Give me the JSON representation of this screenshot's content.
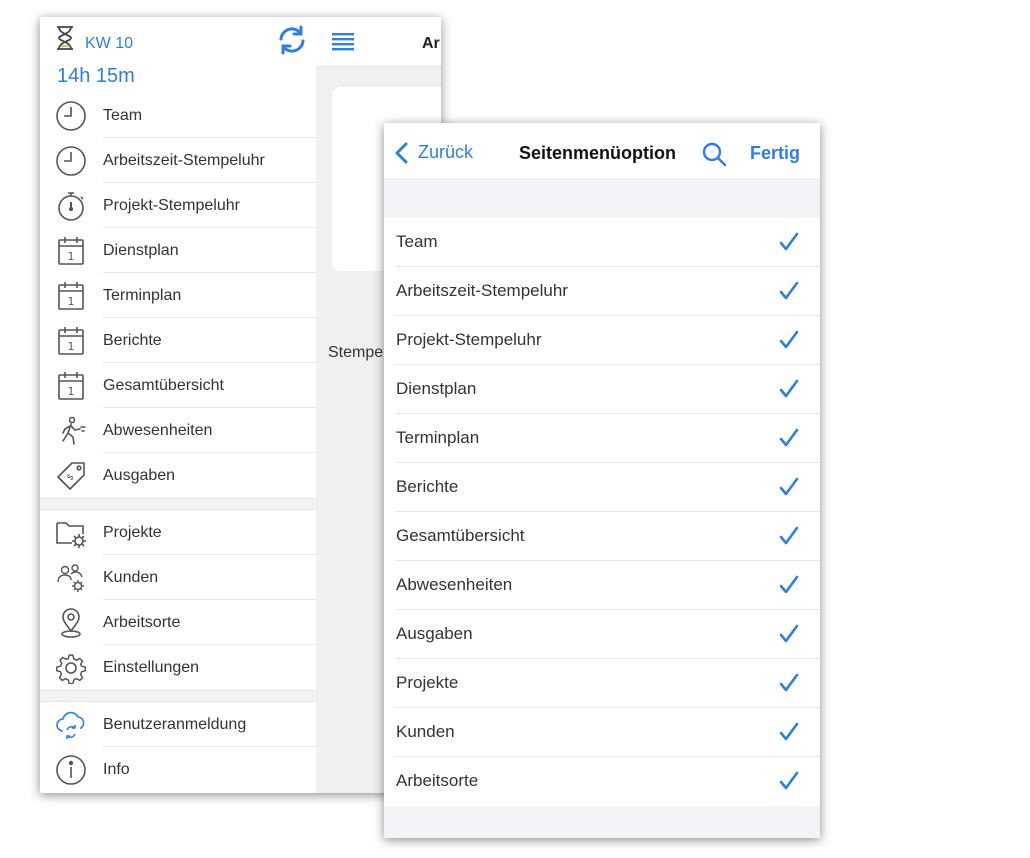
{
  "colors": {
    "accent": "#2f7ee0",
    "icon_gray": "#555555",
    "hourglass_sand": "#e0c066"
  },
  "back_screen": {
    "week_label": "KW 10",
    "hours_label": "14h 15m",
    "main_title_partial": "Ar",
    "main_text_partial": "Stempe",
    "menu_groups": [
      [
        {
          "label": "Team",
          "icon": "clock-icon"
        },
        {
          "label": "Arbeitszeit-Stempeluhr",
          "icon": "clock-icon"
        },
        {
          "label": "Projekt-Stempeluhr",
          "icon": "stopwatch-icon"
        },
        {
          "label": "Dienstplan",
          "icon": "calendar-icon"
        },
        {
          "label": "Terminplan",
          "icon": "calendar-icon"
        },
        {
          "label": "Berichte",
          "icon": "calendar-icon"
        },
        {
          "label": "Gesamtübersicht",
          "icon": "calendar-icon"
        },
        {
          "label": "Abwesenheiten",
          "icon": "running-person-icon"
        },
        {
          "label": "Ausgaben",
          "icon": "price-tag-icon"
        }
      ],
      [
        {
          "label": "Projekte",
          "icon": "folder-gear-icon"
        },
        {
          "label": "Kunden",
          "icon": "people-gear-icon"
        },
        {
          "label": "Arbeitsorte",
          "icon": "location-pin-icon"
        },
        {
          "label": "Einstellungen",
          "icon": "gear-icon"
        }
      ],
      [
        {
          "label": "Benutzeranmeldung",
          "icon": "cloud-sync-icon"
        },
        {
          "label": "Info",
          "icon": "info-icon"
        }
      ]
    ]
  },
  "front_screen": {
    "back_label": "Zurück",
    "title": "Seitenmenüoption",
    "done_label": "Fertig",
    "options": [
      {
        "label": "Team",
        "checked": true
      },
      {
        "label": "Arbeitszeit-Stempeluhr",
        "checked": true
      },
      {
        "label": "Projekt-Stempeluhr",
        "checked": true
      },
      {
        "label": "Dienstplan",
        "checked": true
      },
      {
        "label": "Terminplan",
        "checked": true
      },
      {
        "label": "Berichte",
        "checked": true
      },
      {
        "label": "Gesamtübersicht",
        "checked": true
      },
      {
        "label": "Abwesenheiten",
        "checked": true
      },
      {
        "label": "Ausgaben",
        "checked": true
      },
      {
        "label": "Projekte",
        "checked": true
      },
      {
        "label": "Kunden",
        "checked": true
      },
      {
        "label": "Arbeitsorte",
        "checked": true
      }
    ]
  }
}
